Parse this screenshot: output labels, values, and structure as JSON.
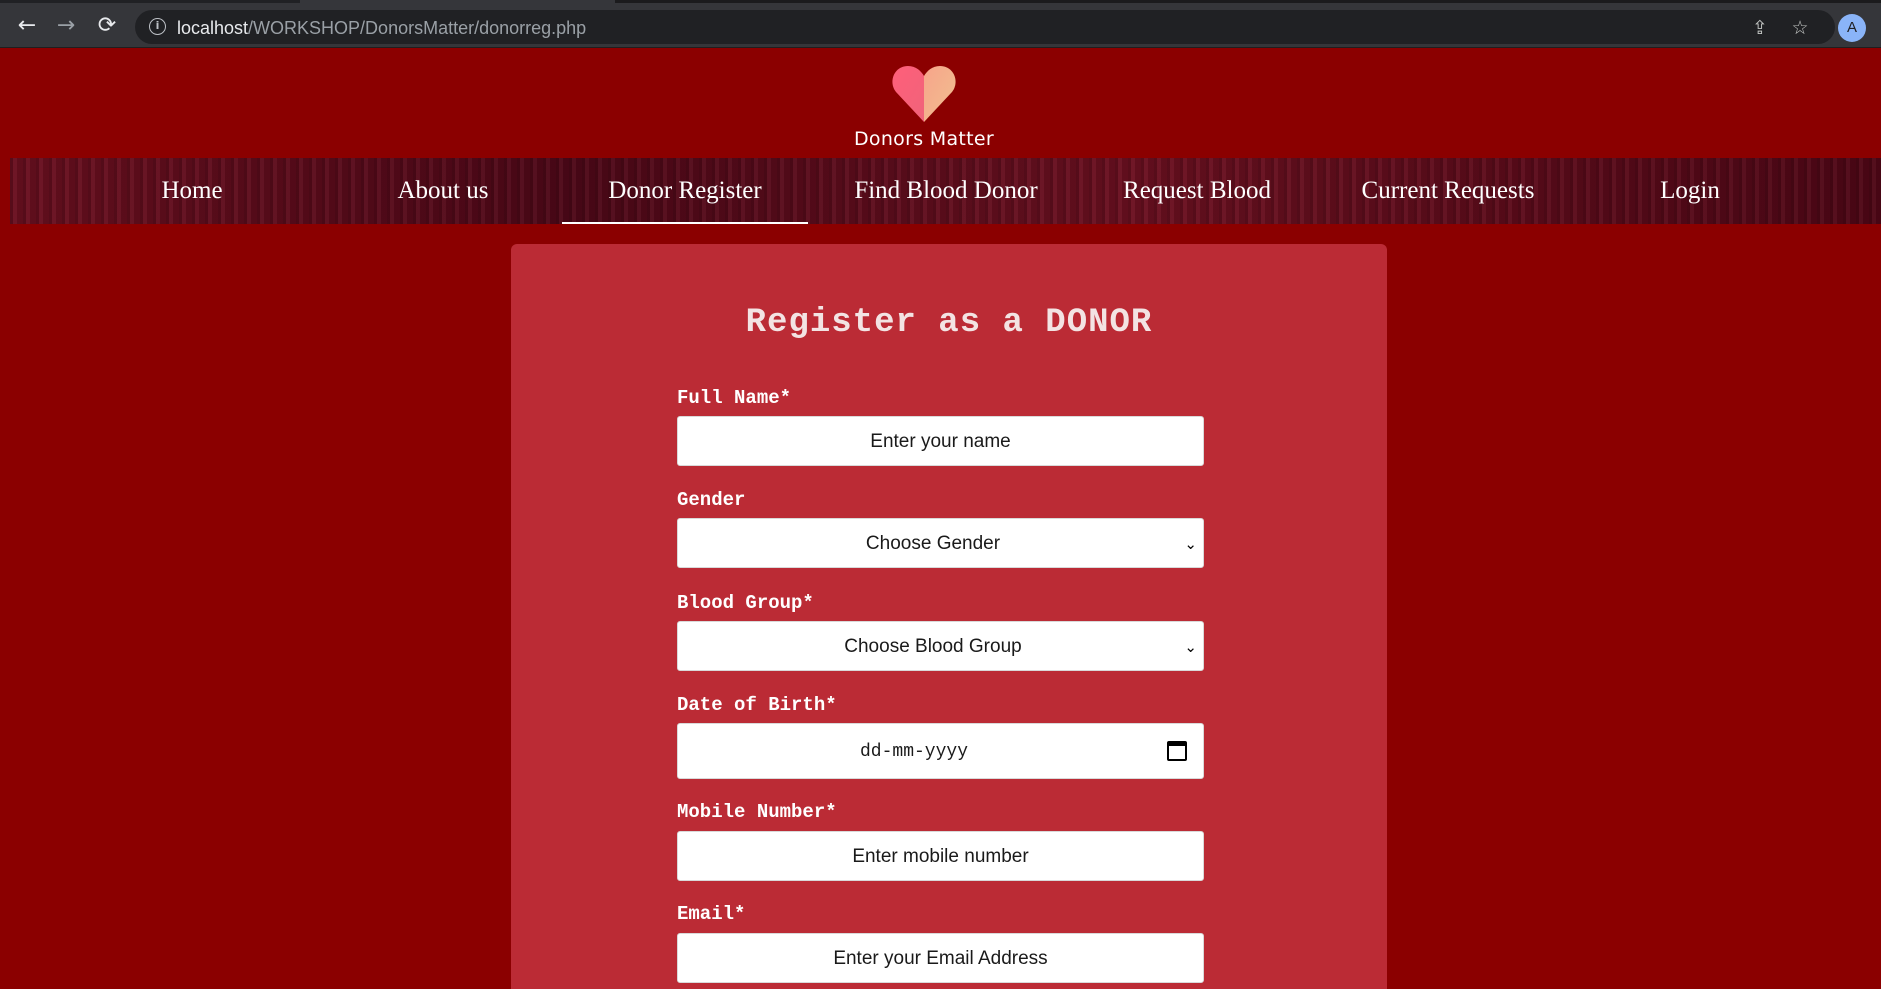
{
  "browser": {
    "url_host": "localhost",
    "url_path": "/WORKSHOP/DonorsMatter/donorreg.php",
    "back_icon": "←",
    "forward_icon": "→",
    "reload_icon": "⟳",
    "info_icon": "i",
    "share_icon": "⇪",
    "star_icon": "☆",
    "avatar_letter": "A"
  },
  "logo": {
    "text": "Donors Matter"
  },
  "nav": {
    "items": [
      {
        "label": "Home"
      },
      {
        "label": "About us"
      },
      {
        "label": "Donor Register",
        "active": true
      },
      {
        "label": "Find Blood Donor"
      },
      {
        "label": "Request Blood"
      },
      {
        "label": "Current Requests"
      },
      {
        "label": "Login"
      }
    ]
  },
  "form": {
    "title": "Register as a DONOR",
    "full_name": {
      "label": "Full Name*",
      "placeholder": "Enter your name"
    },
    "gender": {
      "label": "Gender",
      "selected": "Choose Gender"
    },
    "blood_group": {
      "label": "Blood Group*",
      "selected": "Choose Blood Group"
    },
    "dob": {
      "label": "Date of Birth*",
      "placeholder": "dd-mm-yyyy"
    },
    "mobile": {
      "label": "Mobile Number*",
      "placeholder": "Enter mobile number"
    },
    "email": {
      "label": "Email*",
      "placeholder": "Enter your Email Address"
    }
  },
  "colors": {
    "page_bg": "#8b0000",
    "card_bg": "#bb2b35",
    "nav_bg": "#5a0a1a"
  }
}
